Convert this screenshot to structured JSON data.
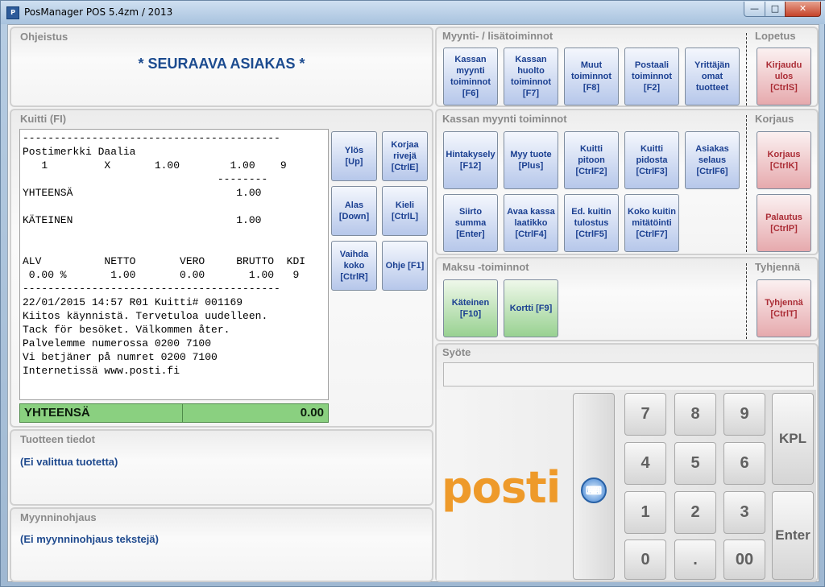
{
  "window": {
    "title": "PosManager POS 5.4zm / 2013",
    "min": "—",
    "max": "□",
    "close": "✕"
  },
  "ohjeistus": {
    "title": "Ohjeistus",
    "message": "* SEURAAVA ASIAKAS *"
  },
  "myynti": {
    "title": "Myynti- / lisätoiminnot",
    "buttons": [
      "Kassan\nmyynti\ntoiminnot\n[F6]",
      "Kassan\nhuolto\ntoiminnot\n[F7]",
      "Muut\ntoiminnot\n[F8]",
      "Postaali\ntoiminnot\n[F2]",
      "Yrittäjän\nomat\ntuotteet"
    ]
  },
  "lopetus": {
    "title": "Lopetus",
    "button": "Kirjaudu\nulos\n[CtrlS]"
  },
  "kuitti": {
    "title": "Kuitti (FI)",
    "lines": [
      "-----------------------------------------",
      "Postimerkki Daalia",
      "   1         X       1.00        1.00    9",
      "                               --------",
      "YHTEENSÄ                          1.00",
      "",
      "KÄTEINEN                          1.00",
      "",
      "",
      "ALV          NETTO       VERO     BRUTTO  KDI",
      " 0.00 %       1.00       0.00       1.00   9",
      "-----------------------------------------",
      "22/01/2015 14:57 R01 Kuitti# 001169",
      "Kiitos käynnistä. Tervetuloa uudelleen.",
      "Tack för besöket. Välkommen åter.",
      "Palvelemme numerossa 0200 7100",
      "Vi betjäner på numret 0200 7100",
      "Internetissä www.posti.fi"
    ],
    "total_label": "YHTEENSÄ",
    "total_value": "0.00",
    "buttons": [
      "Ylös\n[Up]",
      "Korjaa\nrivejä\n[CtrlE]",
      "Alas\n[Down]",
      "Kieli\n[CtrlL]",
      "Vaihda\nkoko\n[CtrlR]",
      "Ohje [F1]"
    ]
  },
  "kassan": {
    "title": "Kassan myynti toiminnot",
    "buttons": [
      "Hintakysely\n[F12]",
      "Myy tuote\n[Plus]",
      "Kuitti\npitoon\n[CtrlF2]",
      "Kuitti\npidosta\n[CtrlF3]",
      "Asiakas\nselaus\n[CtrlF6]",
      "Siirto\nsumma\n[Enter]",
      "Avaa kassa\nlaatikko\n[CtrlF4]",
      "Ed. kuitin\ntulostus\n[CtrlF5]",
      "Koko kuitin\nmitätöinti\n[CtrlF7]"
    ]
  },
  "korjaus": {
    "title": "Korjaus",
    "buttons": [
      "Korjaus\n[CtrlK]",
      "Palautus\n[CtrlP]"
    ]
  },
  "maksu": {
    "title": "Maksu -toiminnot",
    "buttons": [
      "Käteinen\n[F10]",
      "Kortti [F9]"
    ]
  },
  "tyhjenna": {
    "title": "Tyhjennä",
    "button": "Tyhjennä\n[CtrlT]"
  },
  "syote": {
    "title": "Syöte",
    "value": "",
    "logo": "posti",
    "keyboard_icon": "keyboard-icon",
    "keys": {
      "k7": "7",
      "k8": "8",
      "k9": "9",
      "k4": "4",
      "k5": "5",
      "k6": "6",
      "k1": "1",
      "k2": "2",
      "k3": "3",
      "k0": "0",
      "kdot": ".",
      "k00": "00",
      "kpl": "KPL",
      "enter": "Enter"
    }
  },
  "tuote": {
    "title": "Tuotteen tiedot",
    "text": "(Ei valittua tuotetta)"
  },
  "myynninohjaus": {
    "title": "Myynninohjaus",
    "text": "(Ei myynninohjaus tekstejä)"
  }
}
